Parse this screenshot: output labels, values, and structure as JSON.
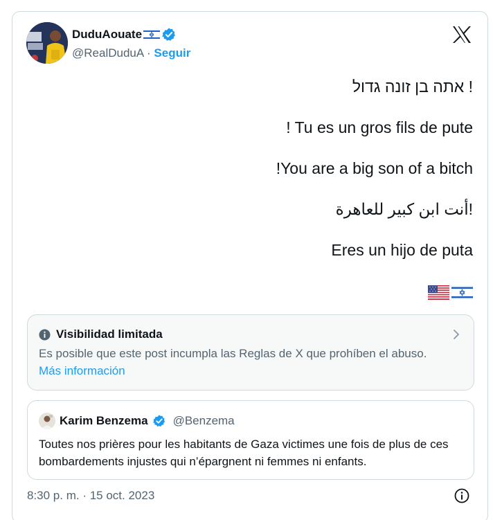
{
  "author": {
    "name": "DuduAouate",
    "handle": "@RealDuduA",
    "separator": "·",
    "follow_label": "Seguir",
    "avatar_icon": "profile-photo-icon",
    "verified_icon": "verified-badge-icon",
    "name_flag_icon": "israel-flag-icon"
  },
  "tweet": {
    "lines": [
      "אתה בן זונה גדול !",
      "! Tu es un gros fils de pute",
      "!You are a big son of a bitch",
      "أنت ابن كبير للعاهرة!",
      "Eres un hijo de puta"
    ],
    "flags": [
      "us-flag-icon",
      "israel-flag-icon"
    ]
  },
  "notice": {
    "title": "Visibilidad limitada",
    "body": "Es posible que este post incumpla las Reglas de X que prohíben el abuso.",
    "link": "Más información"
  },
  "quote": {
    "name": "Karim Benzema",
    "handle": "@Benzema",
    "text": "Toutes nos prières pour les habitants de Gaza victimes une fois de plus de ces bombardements injustes qui n’épargnent ni femmes ni enfants."
  },
  "timestamp": "8:30 p. m. · 15 oct. 2023",
  "colors": {
    "accent": "#1d9bf0",
    "text": "#0f1419",
    "secondary": "#536471",
    "border": "#cfd9de"
  }
}
